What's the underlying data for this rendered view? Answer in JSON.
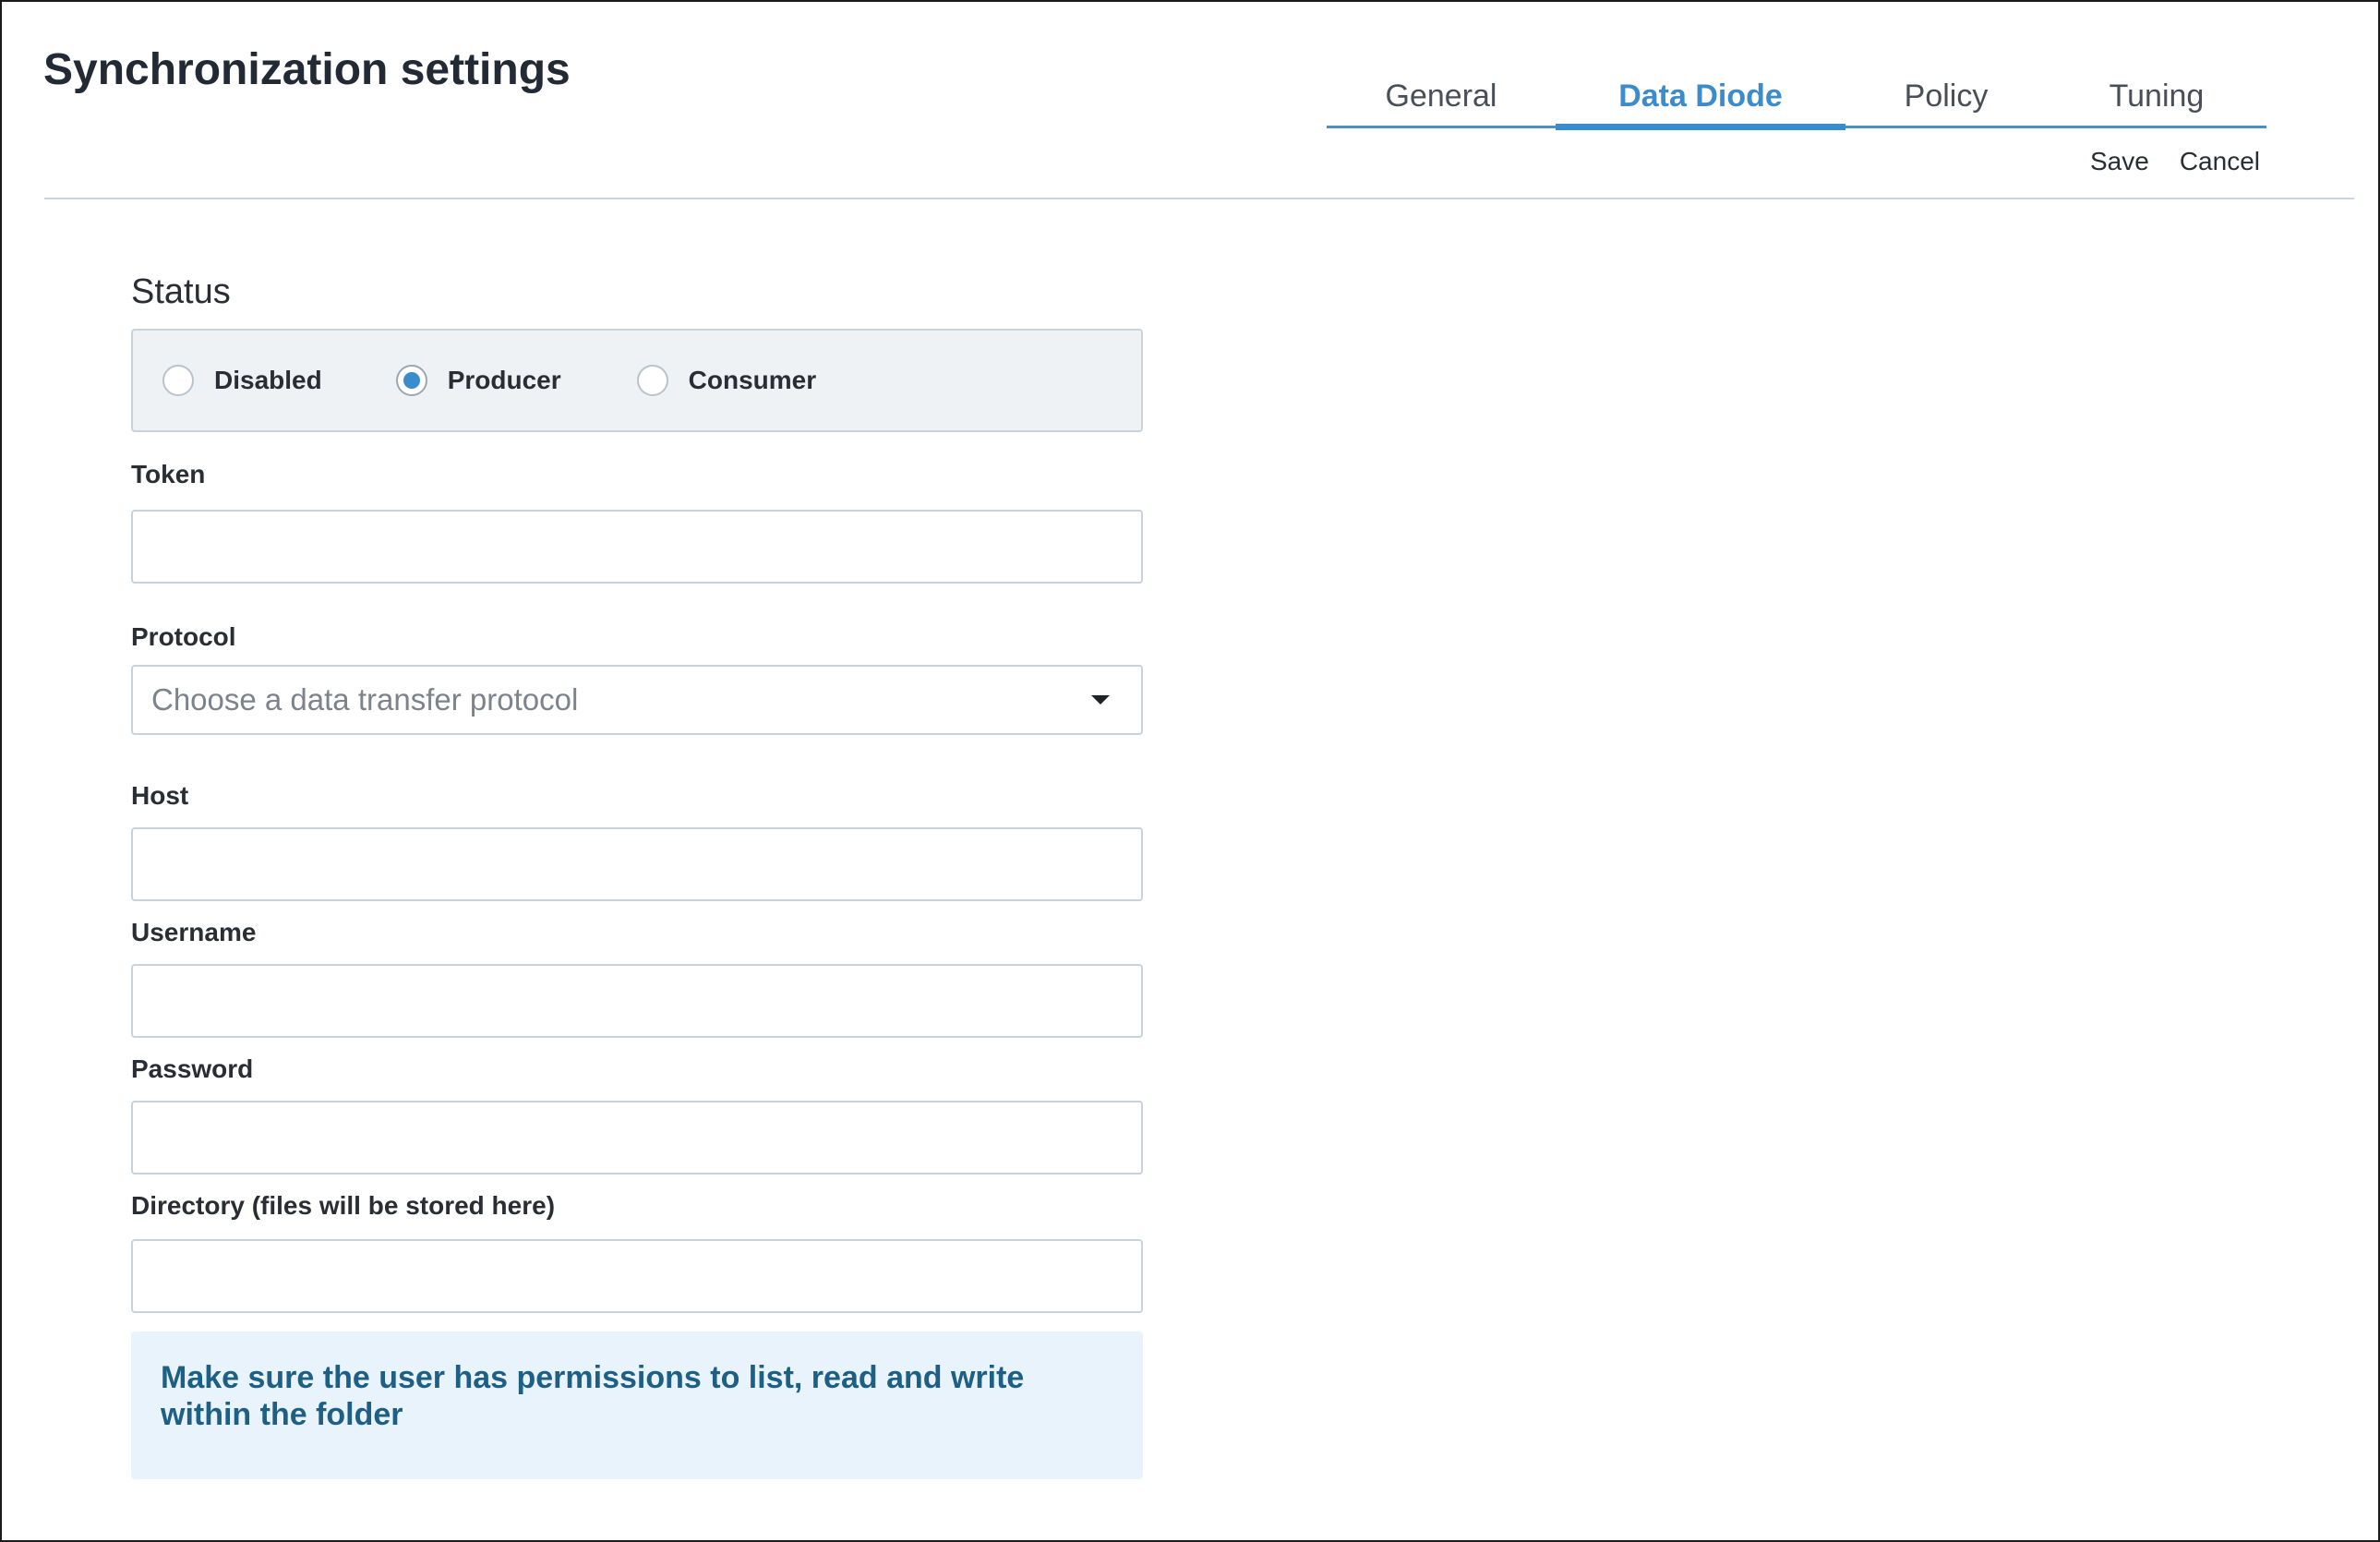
{
  "header": {
    "title": "Synchronization settings",
    "tabs": [
      {
        "label": "General",
        "active": false
      },
      {
        "label": "Data Diode",
        "active": true
      },
      {
        "label": "Policy",
        "active": false
      },
      {
        "label": "Tuning",
        "active": false
      }
    ],
    "save_label": "Save",
    "cancel_label": "Cancel"
  },
  "form": {
    "status": {
      "heading": "Status",
      "options": [
        {
          "label": "Disabled",
          "checked": false
        },
        {
          "label": "Producer",
          "checked": true
        },
        {
          "label": "Consumer",
          "checked": false
        }
      ]
    },
    "token": {
      "label": "Token",
      "value": ""
    },
    "protocol": {
      "label": "Protocol",
      "placeholder": "Choose a data transfer protocol"
    },
    "host": {
      "label": "Host",
      "value": ""
    },
    "username": {
      "label": "Username",
      "value": ""
    },
    "password": {
      "label": "Password",
      "value": ""
    },
    "directory": {
      "label": "Directory (files will be stored here)",
      "value": ""
    },
    "info_message": "Make sure the user has permissions to list, read and write within the folder"
  },
  "colors": {
    "accent": "#3b8ccc",
    "info_bg": "#e8f3fb",
    "info_text": "#1e5f85",
    "panel_bg": "#eff2f5",
    "border": "#c9d3db"
  },
  "icons": {
    "dropdown": "chevron-down-icon"
  }
}
